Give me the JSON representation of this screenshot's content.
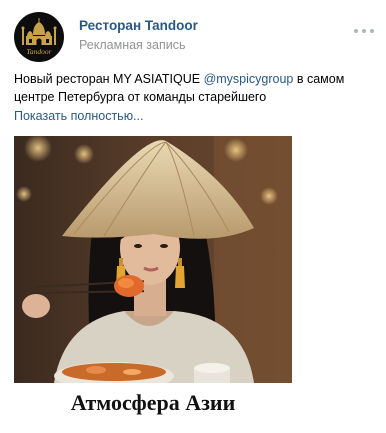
{
  "post": {
    "author": "Ресторан Tandoor",
    "ad_label": "Рекламная запись",
    "text_before": "Новый ресторан MY ASIATIQUE ",
    "mention": "@myspicygroup",
    "text_after": " в самом центре Петербурга от команды старейшего",
    "show_more": "Показать полностью...",
    "image_caption": "Атмосфера Азии",
    "avatar_logo_text": "Tandoor"
  },
  "icons": {
    "more": "more-horizontal-icon",
    "logo": "taj-mahal-logo-icon"
  },
  "colors": {
    "link": "#2a5885",
    "secondary_text": "#939393",
    "avatar_bg": "#0d0d0d",
    "logo_gold": "#c8a24a"
  }
}
